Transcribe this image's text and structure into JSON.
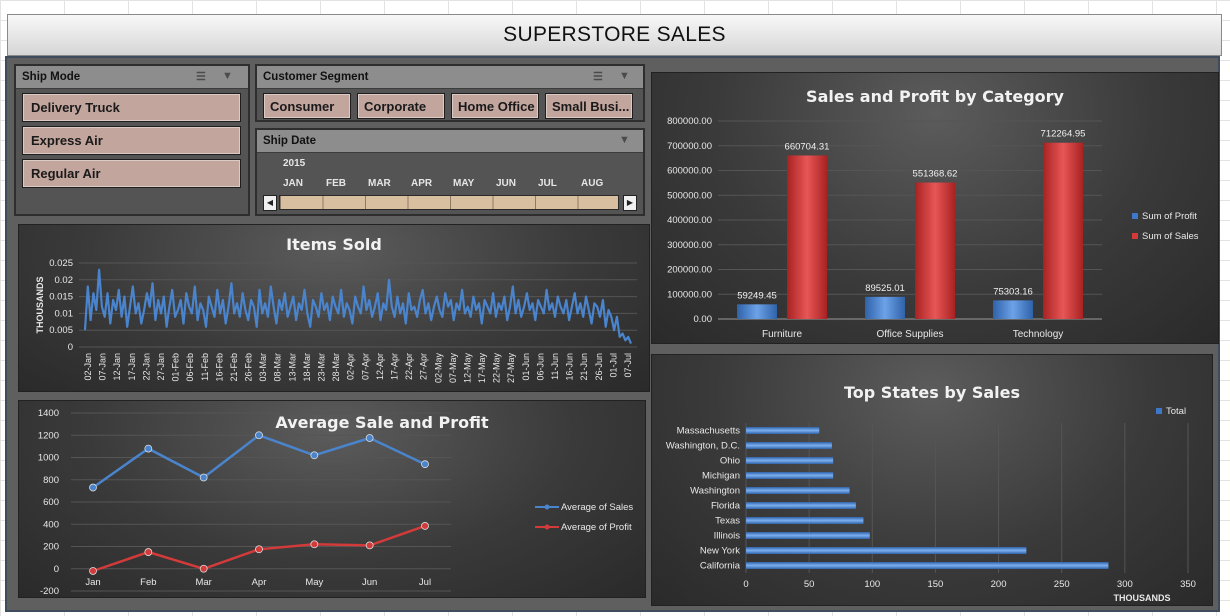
{
  "header": {
    "title": "SUPERSTORE SALES"
  },
  "ship_mode": {
    "title": "Ship Mode",
    "items": [
      "Delivery Truck",
      "Express Air",
      "Regular Air"
    ]
  },
  "segment": {
    "title": "Customer Segment",
    "items": [
      "Consumer",
      "Corporate",
      "Home Office",
      "Small Busi..."
    ]
  },
  "ship_date": {
    "title": "Ship Date",
    "year": "2015",
    "months": [
      "JAN",
      "FEB",
      "MAR",
      "APR",
      "MAY",
      "JUN",
      "JUL",
      "AUG"
    ],
    "scroll_left": "◀",
    "scroll_right": "▶"
  },
  "colors": {
    "profit": "#3d78c8",
    "sales": "#d33a3a",
    "line": "#4a84cc",
    "slicer_item": "#c2a59d",
    "timeline": "#d8bfa0"
  },
  "chart_data": [
    {
      "type": "line",
      "title": "Items Sold",
      "ylabel": "THOUSANDS",
      "ylim": [
        0,
        0.025
      ],
      "yticks": [
        "0.025",
        "0.02",
        "0.015",
        "0.01",
        "0.005",
        "0"
      ],
      "xticklabels": [
        "02-Jan",
        "07-Jan",
        "12-Jan",
        "17-Jan",
        "22-Jan",
        "27-Jan",
        "01-Feb",
        "06-Feb",
        "11-Feb",
        "16-Feb",
        "21-Feb",
        "26-Feb",
        "03-Mar",
        "08-Mar",
        "13-Mar",
        "18-Mar",
        "23-Mar",
        "28-Mar",
        "02-Apr",
        "07-Apr",
        "12-Apr",
        "17-Apr",
        "22-Apr",
        "27-Apr",
        "02-May",
        "07-May",
        "12-May",
        "17-May",
        "22-May",
        "27-May",
        "01-Jun",
        "06-Jun",
        "11-Jun",
        "16-Jun",
        "21-Jun",
        "26-Jun",
        "01-Jul",
        "07-Jul"
      ],
      "values": [
        0.005,
        0.018,
        0.008,
        0.016,
        0.011,
        0.023,
        0.012,
        0.009,
        0.016,
        0.007,
        0.014,
        0.011,
        0.017,
        0.009,
        0.015,
        0.006,
        0.012,
        0.018,
        0.01,
        0.013,
        0.007,
        0.011,
        0.016,
        0.012,
        0.019,
        0.008,
        0.014,
        0.01,
        0.015,
        0.006,
        0.012,
        0.017,
        0.009,
        0.011,
        0.014,
        0.007,
        0.016,
        0.012,
        0.01,
        0.018,
        0.008,
        0.013,
        0.011,
        0.006,
        0.015,
        0.012,
        0.009,
        0.017,
        0.01,
        0.014,
        0.007,
        0.012,
        0.019,
        0.01,
        0.013,
        0.009,
        0.016,
        0.011,
        0.008,
        0.014,
        0.012,
        0.006,
        0.017,
        0.01,
        0.013,
        0.009,
        0.018,
        0.012,
        0.007,
        0.014,
        0.011,
        0.016,
        0.009,
        0.012,
        0.015,
        0.008,
        0.013,
        0.011,
        0.017,
        0.01,
        0.006,
        0.014,
        0.012,
        0.009,
        0.016,
        0.011,
        0.013,
        0.008,
        0.015,
        0.012,
        0.01,
        0.017,
        0.009,
        0.013,
        0.011,
        0.007,
        0.015,
        0.012,
        0.01,
        0.018,
        0.011,
        0.014,
        0.009,
        0.012,
        0.016,
        0.008,
        0.013,
        0.011,
        0.02,
        0.012,
        0.009,
        0.015,
        0.01,
        0.013,
        0.007,
        0.016,
        0.011,
        0.012,
        0.009,
        0.014,
        0.017,
        0.01,
        0.013,
        0.008,
        0.012,
        0.015,
        0.011,
        0.009,
        0.016,
        0.012,
        0.014,
        0.008,
        0.013,
        0.011,
        0.017,
        0.01,
        0.012,
        0.009,
        0.015,
        0.011,
        0.013,
        0.007,
        0.014,
        0.012,
        0.01,
        0.016,
        0.009,
        0.013,
        0.011,
        0.015,
        0.008,
        0.012,
        0.018,
        0.01,
        0.014,
        0.009,
        0.012,
        0.016,
        0.011,
        0.013,
        0.008,
        0.014,
        0.012,
        0.01,
        0.017,
        0.011,
        0.013,
        0.009,
        0.015,
        0.012,
        0.01,
        0.014,
        0.008,
        0.012,
        0.016,
        0.01,
        0.013,
        0.009,
        0.015,
        0.011,
        0.007,
        0.013,
        0.012,
        0.009,
        0.014,
        0.006,
        0.011,
        0.009,
        0.005,
        0.009,
        0.003,
        0.004,
        0.002,
        0.003,
        0.001
      ],
      "grid": true
    },
    {
      "type": "bar",
      "title": "Sales and Profit by Category",
      "categories": [
        "Furniture",
        "Office Supplies",
        "Technology"
      ],
      "series": [
        {
          "name": "Sum of Profit",
          "values": [
            59249.45,
            89525.01,
            75303.16
          ],
          "labels": [
            "59249.45",
            "89525.01",
            "75303.16"
          ]
        },
        {
          "name": "Sum of Sales",
          "values": [
            660704.31,
            551368.62,
            712264.95
          ],
          "labels": [
            "660704.31",
            "551368.62",
            "712264.95"
          ]
        }
      ],
      "ylim": [
        0,
        800000
      ],
      "yticks": [
        "800000.00",
        "700000.00",
        "600000.00",
        "500000.00",
        "400000.00",
        "300000.00",
        "200000.00",
        "100000.00",
        "0.00"
      ],
      "legend": "right",
      "grid": true
    },
    {
      "type": "line",
      "title": "Average Sale and Profit",
      "categories": [
        "Jan",
        "Feb",
        "Mar",
        "Apr",
        "May",
        "Jun",
        "Jul"
      ],
      "series": [
        {
          "name": "Average of Sales",
          "values": [
            730,
            1080,
            820,
            1200,
            1020,
            1175,
            940
          ]
        },
        {
          "name": "Average of Profit",
          "values": [
            -20,
            150,
            0,
            175,
            220,
            210,
            385
          ]
        }
      ],
      "ylim": [
        -200,
        1400
      ],
      "yticks": [
        "1400",
        "1200",
        "1000",
        "800",
        "600",
        "400",
        "200",
        "0",
        "-200"
      ],
      "legend": "right",
      "grid": true
    },
    {
      "type": "bar",
      "orientation": "horizontal",
      "title": "Top States by Sales",
      "categories": [
        "Massachusetts",
        "Washington, D.C.",
        "Ohio",
        "Michigan",
        "Washington",
        "Florida",
        "Texas",
        "Illinois",
        "New York",
        "California"
      ],
      "series": [
        {
          "name": "Total",
          "values": [
            58,
            68,
            69,
            69,
            82,
            87,
            93,
            98,
            222,
            287
          ]
        }
      ],
      "xlim": [
        0,
        350
      ],
      "xticks": [
        "0",
        "50",
        "100",
        "150",
        "200",
        "250",
        "300",
        "350"
      ],
      "xlabel": "THOUSANDS",
      "legend": "top-right",
      "grid": true
    }
  ]
}
